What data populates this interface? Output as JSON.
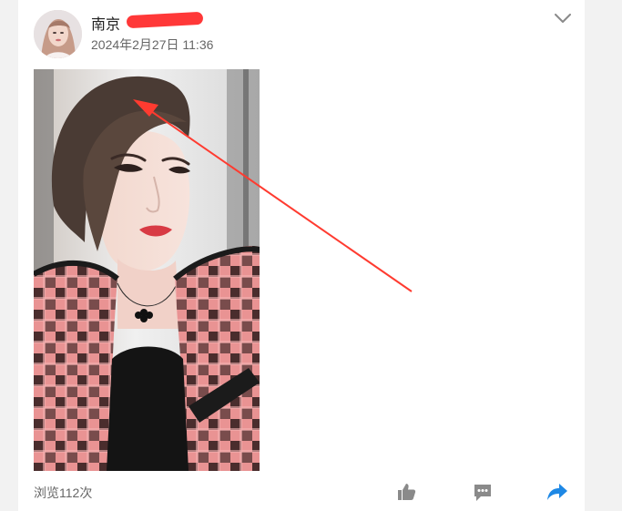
{
  "post": {
    "author_name": "南京",
    "timestamp": "2024年2月27日 11:36",
    "view_count": "浏览112次"
  },
  "icons": {
    "menu": "chevron-down-icon",
    "like": "thumbs-up-icon",
    "comment": "comment-icon",
    "share": "share-arrow-icon"
  },
  "colors": {
    "card_bg": "#ffffff",
    "page_bg": "#f2f2f2",
    "annotation_arrow": "#ff3b30",
    "action_icon": "#8a8a8a",
    "share_icon": "#1e88e5"
  }
}
